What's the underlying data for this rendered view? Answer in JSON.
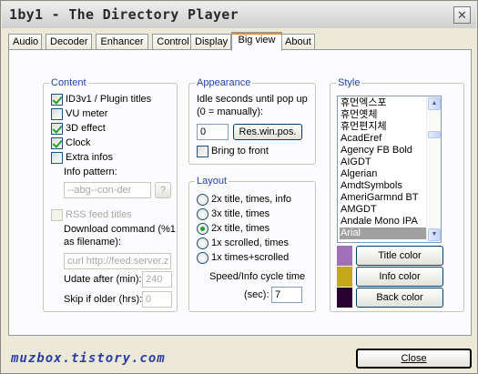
{
  "window": {
    "title": "1by1 - The Directory Player",
    "close_glyph": "✕"
  },
  "tabs": [
    {
      "label": "Audio"
    },
    {
      "label": "Decoder"
    },
    {
      "label": "Enhancer"
    },
    {
      "label": "Control"
    },
    {
      "label": "Display"
    },
    {
      "label": "Big view",
      "active": true
    },
    {
      "label": "About"
    }
  ],
  "content": {
    "title": "Content",
    "id3_label": "ID3v1 / Plugin titles",
    "id3_checked": true,
    "vu_label": "VU meter",
    "vu_checked": false,
    "effect3d_label": "3D effect",
    "effect3d_checked": true,
    "clock_label": "Clock",
    "clock_checked": true,
    "extra_label": "Extra infos",
    "extra_checked": false,
    "info_pattern_label": "Info pattern:",
    "info_pattern_value": "--abg--con-der",
    "help_button": "?",
    "rss_label": "RSS feed titles",
    "rss_checked": false,
    "download_cmd_label_1": "Download command (%1",
    "download_cmd_label_2": "as filename):",
    "download_cmd_value": "curl http://feed.server.z",
    "update_label": "Udate after (min):",
    "update_value": "240",
    "skip_label": "Skip if older (hrs):",
    "skip_value": "0"
  },
  "appearance": {
    "title": "Appearance",
    "idle_label_1": "Idle seconds until pop up",
    "idle_label_2": "(0 = manually):",
    "idle_value": "0",
    "res_button": "Res.win.pos.",
    "bring_front_label": "Bring to front",
    "bring_front_checked": false
  },
  "layout": {
    "title": "Layout",
    "options": [
      {
        "label": "2x title, times, info",
        "checked": false
      },
      {
        "label": "3x title, times",
        "checked": false
      },
      {
        "label": "2x title, times",
        "checked": true
      },
      {
        "label": "1x scrolled, times",
        "checked": false
      },
      {
        "label": "1x times+scrolled",
        "checked": false
      }
    ],
    "cycle_label": "Speed/Info cycle time",
    "sec_label": "(sec):",
    "sec_value": "7"
  },
  "style": {
    "title": "Style",
    "fonts": [
      "휴먼엑스포",
      "휴먼옛체",
      "휴먼편지체",
      "AcadEref",
      "Agency FB Bold",
      "AIGDT",
      "Algerian",
      "AmdtSymbols",
      "AmeriGarmnd BT",
      "AMGDT",
      "Andale Mono IPA",
      "Arial"
    ],
    "selected_font": "Arial",
    "title_color_button": "Title color",
    "info_color_button": "Info color",
    "back_color_button": "Back color",
    "colors": {
      "title": "#a070b8",
      "info": "#c4a81c",
      "back": "#2a0030"
    }
  },
  "footer": {
    "logo_text": "muzbox.tistory.com",
    "close_button": "Close"
  }
}
